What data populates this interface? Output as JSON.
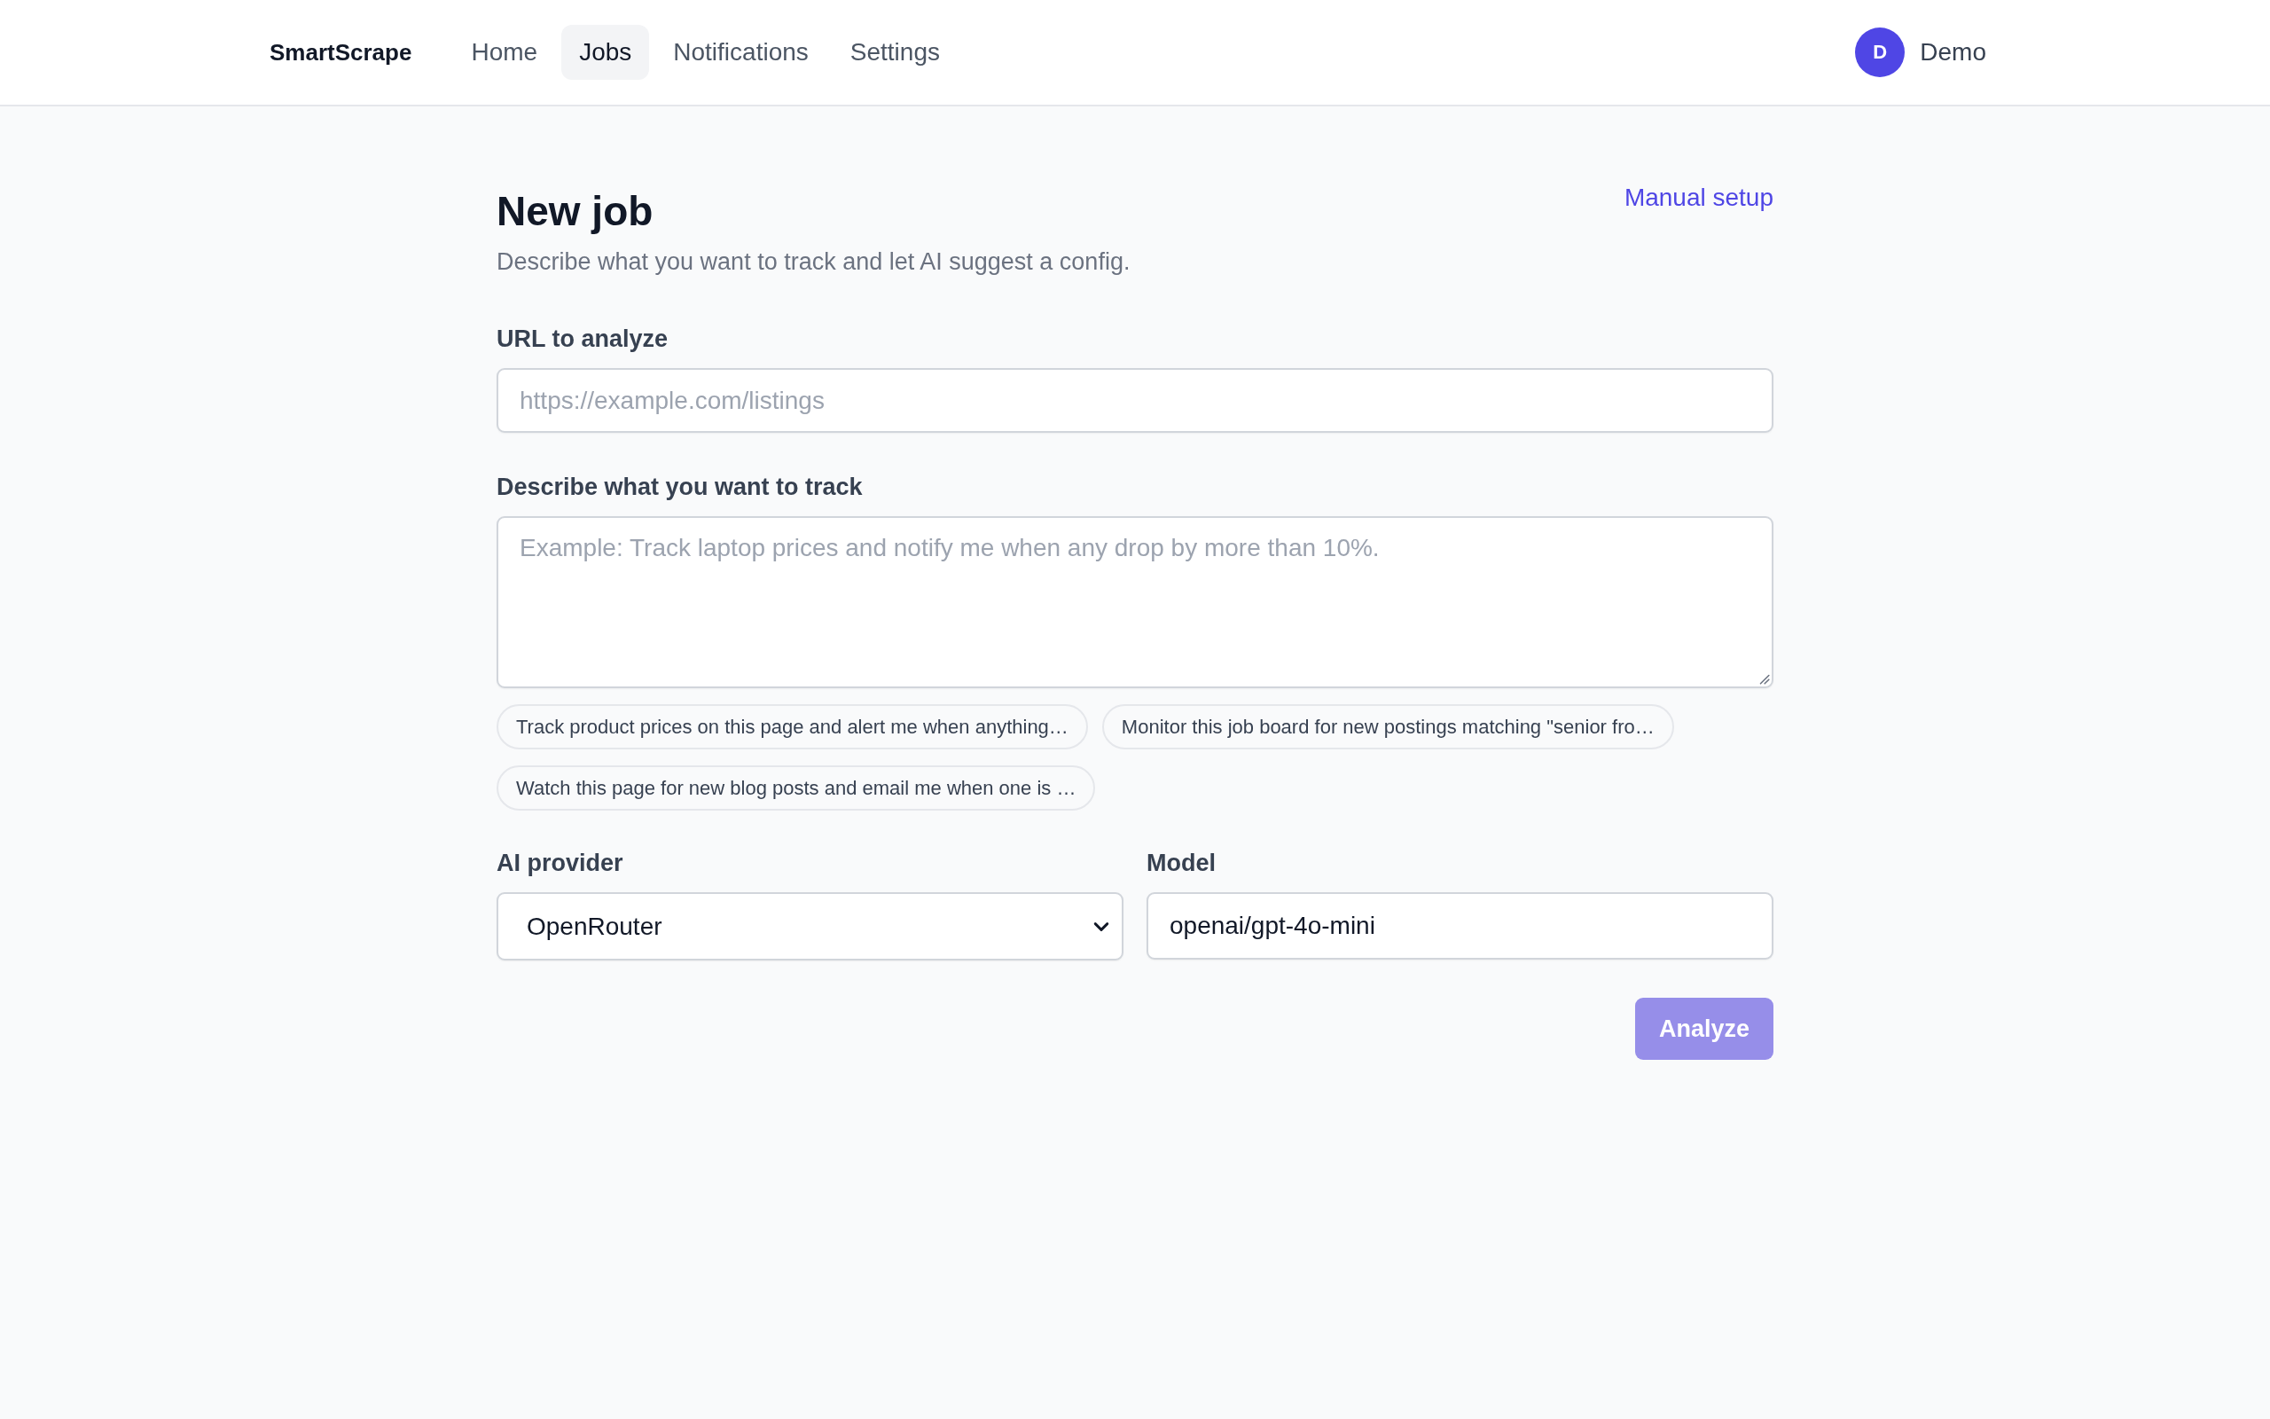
{
  "nav": {
    "brand": "SmartScrape",
    "links": [
      {
        "label": "Home",
        "selected": false
      },
      {
        "label": "Jobs",
        "selected": true
      },
      {
        "label": "Notifications",
        "selected": false
      },
      {
        "label": "Settings",
        "selected": false
      }
    ],
    "user": {
      "initial": "D",
      "name": "Demo"
    }
  },
  "page": {
    "title": "New job",
    "subtitle": "Describe what you want to track and let AI suggest a config.",
    "manual_setup_link": "Manual setup"
  },
  "form": {
    "url": {
      "label": "URL to analyze",
      "placeholder": "https://example.com/listings"
    },
    "description": {
      "label": "Describe what you want to track",
      "placeholder": "Example: Track laptop prices and notify me when any drop by more than 10%."
    },
    "suggestions": [
      "Track product prices on this page and alert me when anything…",
      "Monitor this job board for new postings matching \"senior fro…",
      "Watch this page for new blog posts and email me when one is …"
    ],
    "provider": {
      "label": "AI provider",
      "value": "OpenRouter"
    },
    "model": {
      "label": "Model",
      "value": "openai/gpt-4o-mini"
    },
    "submit": {
      "label": "Analyze",
      "disabled": true
    }
  }
}
